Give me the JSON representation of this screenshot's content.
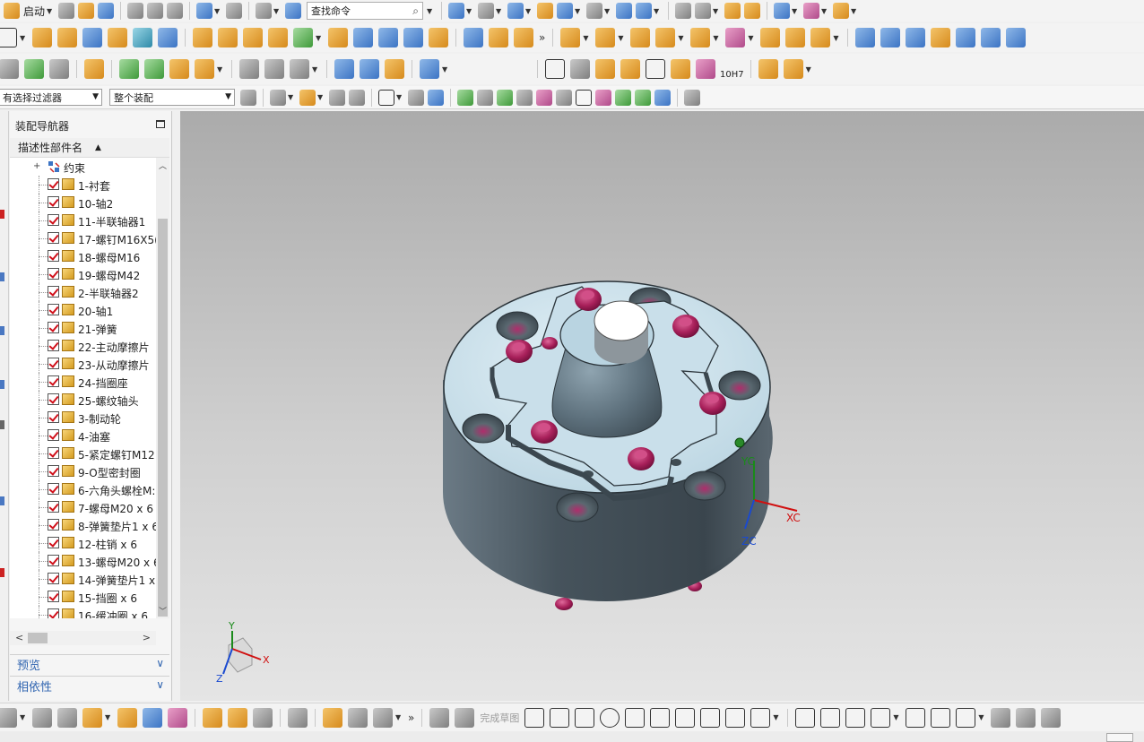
{
  "toolbar_top": {
    "start_label": "启动",
    "command_search": "查找命令"
  },
  "selection_bar": {
    "filter_value": "有选择过滤器",
    "scope_value": "整个装配"
  },
  "toolbar_row3": {
    "fit_label": "10H7"
  },
  "navigator": {
    "title": "装配导航器",
    "column_header": "描述性部件名",
    "constraints_label": "约束",
    "items": [
      "1-衬套",
      "10-轴2",
      "11-半联轴器1",
      "17-螺钉M16X5(",
      "18-螺母M16",
      "19-螺母M42",
      "2-半联轴器2",
      "20-轴1",
      "21-弹簧",
      "22-主动摩擦片",
      "23-从动摩擦片",
      "24-挡圈座",
      "25-螺纹轴头",
      "3-制动轮",
      "4-油塞",
      "5-紧定螺钉M12",
      "9-O型密封圈",
      "6-六角头螺栓M:",
      "7-螺母M20 x 6",
      "8-弹簧垫片1 x 6",
      "12-柱销 x 6",
      "13-螺母M20 x 6",
      "14-弹簧垫片1 x",
      "15-挡圈 x 6",
      "16-缓冲圈 x 6"
    ],
    "preview_label": "预览",
    "dependency_label": "相依性"
  },
  "viewport": {
    "wcs": {
      "xc": "XC",
      "yc": "YC",
      "zc": "ZC"
    },
    "triad": {
      "x": "X",
      "y": "Y",
      "z": "Z"
    }
  },
  "bottom_toolbar": {
    "sketch_label": "完成草图"
  },
  "colors": {
    "body_dark": "#4d5a65",
    "face_light": "#cfe4ee",
    "bolt": "#a8205a",
    "axis_x": "#d01010",
    "axis_y": "#1a8a1a",
    "axis_z": "#1a4ad0",
    "nav_accent": "#2f64b0"
  }
}
